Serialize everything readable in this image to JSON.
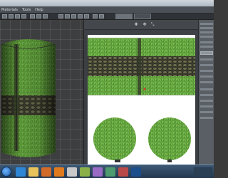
{
  "window": {
    "menu_items": [
      "Materials",
      "Tools",
      "Help"
    ]
  },
  "taskbar": {
    "icons": [
      "start-orb-icon",
      "ie-icon",
      "folder-icon",
      "media-icon",
      "firefox-icon",
      "paint-icon",
      "cube-icon",
      "app-icon",
      "app-icon",
      "app-icon",
      "photoshop-icon"
    ]
  },
  "colors": {
    "grass": "#5f9f3a",
    "stone": "#4a4a38",
    "viewport_bg": "#3d3e40",
    "uv_bg": "#ffffff"
  }
}
